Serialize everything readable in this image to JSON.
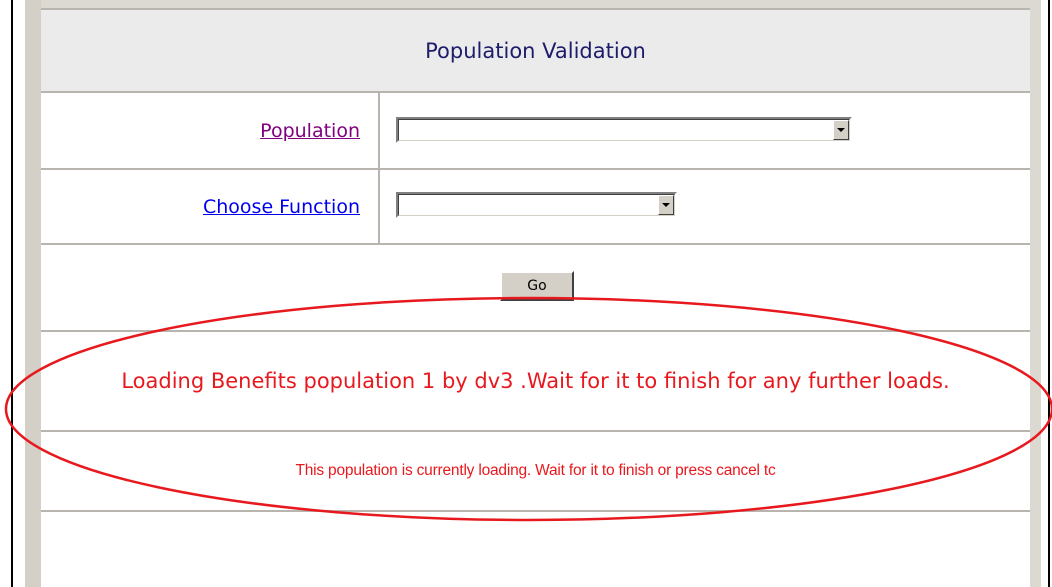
{
  "form": {
    "title": "Population Validation",
    "population_label": "Population",
    "population_value": "",
    "function_label": "Choose Function",
    "function_value": "",
    "go_label": "Go"
  },
  "messages": {
    "loading_status": "Loading Benefits population 1 by dv3 .Wait for it to finish for any further loads.",
    "loading_notice": "This population is currently loading.  Wait for it to finish or press cancel tc"
  },
  "colors": {
    "title_text": "#1c1c6b",
    "visited_link": "#800080",
    "link": "#0000ee",
    "message_text": "#e8191e",
    "annotation_ellipse": "#e8191e"
  },
  "icons": {
    "dropdown": "chevron-down-icon"
  }
}
